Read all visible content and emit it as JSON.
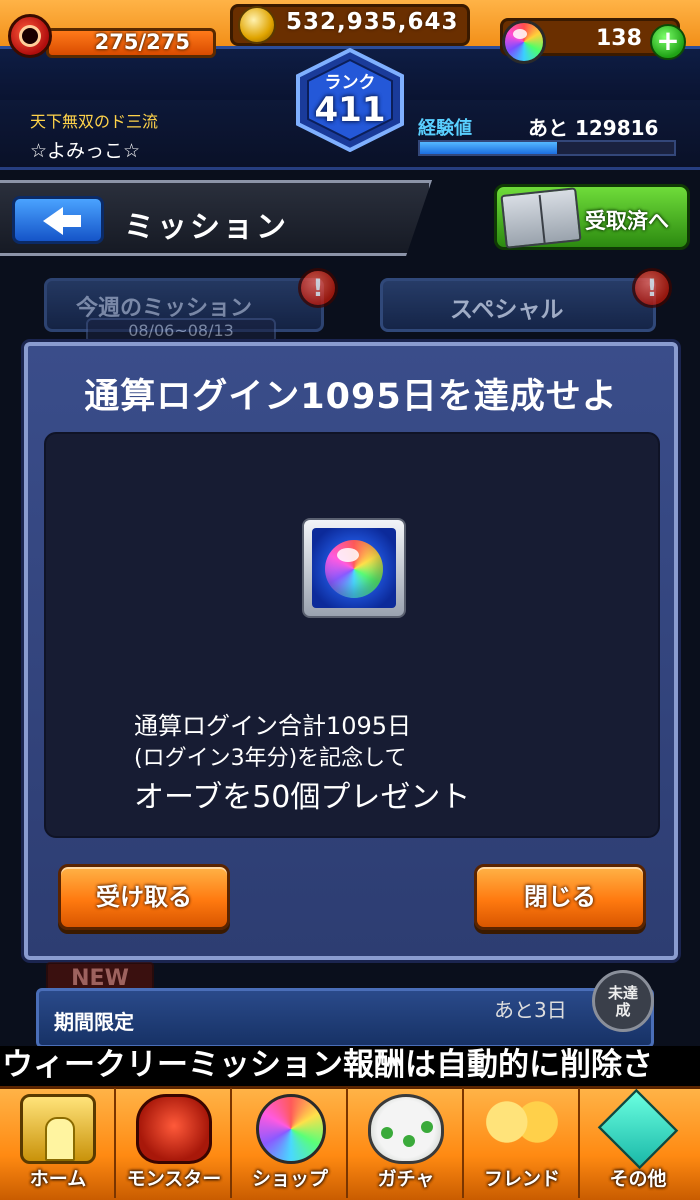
{
  "status": {
    "stamina": "275/275",
    "coins": "532,935,643",
    "orbs": "138",
    "plus_label": "+"
  },
  "rank": {
    "label": "ランク",
    "value": "411"
  },
  "profile": {
    "title": "天下無双のド三流",
    "name": "☆よみっこ☆",
    "exp_label": "経験値",
    "exp_remaining": "あと 129816",
    "exp_progress": 0.54
  },
  "header": {
    "title": "ミッション",
    "received_label": "受取済へ"
  },
  "background_tabs": {
    "weekly_label": "今週のミッション",
    "weekly_dates": "08/06~08/13",
    "special_label": "スペシャル",
    "alert": "!"
  },
  "dialog": {
    "title": "通算ログイン1095日を達成せよ",
    "description": [
      "通算ログイン合計1095日",
      "(ログイン3年分)を記念して",
      "オーブを50個プレゼント"
    ],
    "receive_label": "受け取る",
    "close_label": "閉じる"
  },
  "below": {
    "new_badge": "NEW",
    "limited_label": "期間限定",
    "remaining_days": "あと3日",
    "not_achieved": "未達成"
  },
  "ticker": {
    "text": "ウィークリーミッション報酬は自動的に削除さ"
  },
  "nav": [
    {
      "label": "ホーム",
      "icon": "home-icon"
    },
    {
      "label": "モンスター",
      "icon": "monster-icon"
    },
    {
      "label": "ショップ",
      "icon": "shop-icon"
    },
    {
      "label": "ガチャ",
      "icon": "gacha-icon"
    },
    {
      "label": "フレンド",
      "icon": "friend-icon"
    },
    {
      "label": "その他",
      "icon": "other-icon"
    }
  ],
  "colors": {
    "accent_orange": "#ff8a12",
    "panel_blue": "#2d3d72",
    "exp_blue": "#1c6ee0"
  }
}
